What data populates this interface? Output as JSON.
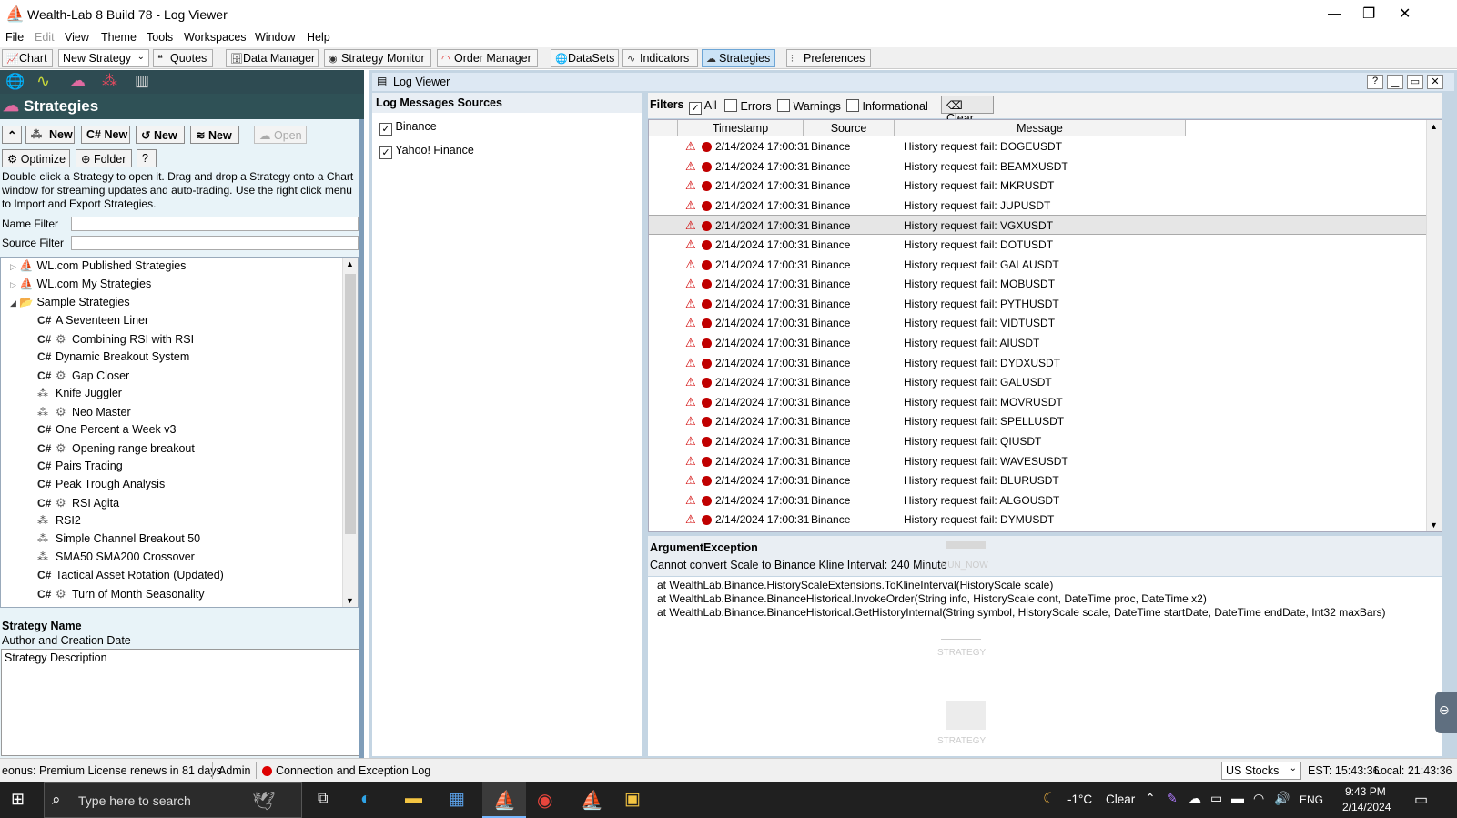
{
  "window": {
    "title": "Wealth-Lab 8 Build 78 - Log Viewer",
    "controls": {
      "minimize": "—",
      "restore": "❐",
      "close": "✕"
    }
  },
  "menu": [
    "File",
    "Edit",
    "View",
    "Theme",
    "Tools",
    "Workspaces",
    "Window",
    "Help"
  ],
  "toolbar": {
    "chart": "Chart",
    "new_strategy": "New Strategy",
    "quotes": "Quotes",
    "data_manager": "Data Manager",
    "strategy_monitor": "Strategy Monitor",
    "order_manager": "Order Manager",
    "datasets": "DataSets",
    "indicators": "Indicators",
    "strategies": "Strategies",
    "preferences": "Preferences"
  },
  "strategies_panel": {
    "title": "Strategies",
    "buttons": {
      "new1": "New",
      "new2": "New",
      "new3": "New",
      "new4": "New",
      "open": "Open",
      "optimize": "Optimize",
      "folder": "Folder",
      "help": "?"
    },
    "cs_label": "C#",
    "help_text": "Double click a Strategy to open it. Drag and drop a Strategy onto a Chart window for streaming updates and auto-trading. Use the right click menu to Import and Export Strategies.",
    "name_filter_label": "Name Filter",
    "source_filter_label": "Source Filter",
    "name_filter_value": "",
    "source_filter_value": "",
    "tree": {
      "roots": [
        "WL.com Published Strategies",
        "WL.com My Strategies",
        "Sample Strategies"
      ],
      "items": [
        {
          "label": "A Seventeen Liner",
          "kind": "cs",
          "opt": false
        },
        {
          "label": "Combining RSI with RSI",
          "kind": "cs",
          "opt": true
        },
        {
          "label": "Dynamic Breakout System",
          "kind": "cs",
          "opt": false
        },
        {
          "label": "Gap Closer",
          "kind": "cs",
          "opt": true
        },
        {
          "label": "Knife Juggler",
          "kind": "blocks",
          "opt": false
        },
        {
          "label": "Neo Master",
          "kind": "blocks",
          "opt": true
        },
        {
          "label": "One Percent a Week v3",
          "kind": "cs",
          "opt": false
        },
        {
          "label": "Opening range breakout",
          "kind": "cs",
          "opt": true
        },
        {
          "label": "Pairs Trading",
          "kind": "cs",
          "opt": false
        },
        {
          "label": "Peak Trough Analysis",
          "kind": "cs",
          "opt": false
        },
        {
          "label": "RSI Agita",
          "kind": "cs",
          "opt": true
        },
        {
          "label": "RSI2",
          "kind": "blocks",
          "opt": false
        },
        {
          "label": "Simple Channel Breakout 50",
          "kind": "blocks",
          "opt": false
        },
        {
          "label": "SMA50 SMA200 Crossover",
          "kind": "blocks",
          "opt": false
        },
        {
          "label": "Tactical Asset Rotation (Updated)",
          "kind": "cs",
          "opt": false
        },
        {
          "label": "Turn of Month Seasonality",
          "kind": "cs",
          "opt": true
        }
      ]
    },
    "strategy_name": "Strategy Name",
    "author_date": "Author and Creation Date",
    "description": "Strategy Description"
  },
  "log_viewer": {
    "title": "Log Viewer",
    "sources_title": "Log Messages Sources",
    "sources": [
      {
        "label": "Binance",
        "checked": true
      },
      {
        "label": "Yahoo! Finance",
        "checked": true
      }
    ],
    "filters_label": "Filters",
    "filters": [
      {
        "label": "All",
        "checked": true
      },
      {
        "label": "Errors",
        "checked": false
      },
      {
        "label": "Warnings",
        "checked": false
      },
      {
        "label": "Informational",
        "checked": false
      }
    ],
    "clear_label": "Clear",
    "columns": [
      "Timestamp",
      "Source",
      "Message"
    ],
    "rows": [
      {
        "ts": "2/14/2024 17:00:31",
        "src": "Binance",
        "msg": "History request fail: DOGEUSDT"
      },
      {
        "ts": "2/14/2024 17:00:31",
        "src": "Binance",
        "msg": "History request fail: BEAMXUSDT"
      },
      {
        "ts": "2/14/2024 17:00:31",
        "src": "Binance",
        "msg": "History request fail: MKRUSDT"
      },
      {
        "ts": "2/14/2024 17:00:31",
        "src": "Binance",
        "msg": "History request fail: JUPUSDT"
      },
      {
        "ts": "2/14/2024 17:00:31",
        "src": "Binance",
        "msg": "History request fail: VGXUSDT",
        "selected": true
      },
      {
        "ts": "2/14/2024 17:00:31",
        "src": "Binance",
        "msg": "History request fail: DOTUSDT"
      },
      {
        "ts": "2/14/2024 17:00:31",
        "src": "Binance",
        "msg": "History request fail: GALAUSDT"
      },
      {
        "ts": "2/14/2024 17:00:31",
        "src": "Binance",
        "msg": "History request fail: MOBUSDT"
      },
      {
        "ts": "2/14/2024 17:00:31",
        "src": "Binance",
        "msg": "History request fail: PYTHUSDT"
      },
      {
        "ts": "2/14/2024 17:00:31",
        "src": "Binance",
        "msg": "History request fail: VIDTUSDT"
      },
      {
        "ts": "2/14/2024 17:00:31",
        "src": "Binance",
        "msg": "History request fail: AIUSDT"
      },
      {
        "ts": "2/14/2024 17:00:31",
        "src": "Binance",
        "msg": "History request fail: DYDXUSDT"
      },
      {
        "ts": "2/14/2024 17:00:31",
        "src": "Binance",
        "msg": "History request fail: GALUSDT"
      },
      {
        "ts": "2/14/2024 17:00:31",
        "src": "Binance",
        "msg": "History request fail: MOVRUSDT"
      },
      {
        "ts": "2/14/2024 17:00:31",
        "src": "Binance",
        "msg": "History request fail: SPELLUSDT"
      },
      {
        "ts": "2/14/2024 17:00:31",
        "src": "Binance",
        "msg": "History request fail: QIUSDT"
      },
      {
        "ts": "2/14/2024 17:00:31",
        "src": "Binance",
        "msg": "History request fail: WAVESUSDT"
      },
      {
        "ts": "2/14/2024 17:00:31",
        "src": "Binance",
        "msg": "History request fail: BLURUSDT"
      },
      {
        "ts": "2/14/2024 17:00:31",
        "src": "Binance",
        "msg": "History request fail: ALGOUSDT"
      },
      {
        "ts": "2/14/2024 17:00:31",
        "src": "Binance",
        "msg": "History request fail: DYMUSDT"
      }
    ],
    "detail": {
      "exception": "ArgumentException",
      "message": "Cannot convert Scale to Binance Kline Interval: 240 Minute",
      "stack": [
        "at WealthLab.Binance.HistoryScaleExtensions.ToKlineInterval(HistoryScale scale)",
        "at WealthLab.Binance.BinanceHistorical.InvokeOrder(String info, HistoryScale cont, DateTime proc, DateTime x2)",
        "at WealthLab.Binance.BinanceHistorical.GetHistoryInternal(String symbol, HistoryScale scale, DateTime startDate, DateTime endDate, Int32 maxBars)"
      ],
      "ghost1": "RUN_NOW",
      "ghost2": "STRATEGY",
      "ghost3": "STRATEGY"
    }
  },
  "statusbar": {
    "license": "eonus: Premium License renews in 81 days",
    "user": "Admin",
    "log": "Connection and Exception Log",
    "market": "US Stocks",
    "est": "EST: 15:43:36",
    "local": "Local: 21:43:36"
  },
  "taskbar": {
    "search_placeholder": "Type here to search",
    "temp": "-1°C",
    "weather": "Clear",
    "lang": "ENG",
    "time": "9:43 PM",
    "date": "2/14/2024"
  }
}
